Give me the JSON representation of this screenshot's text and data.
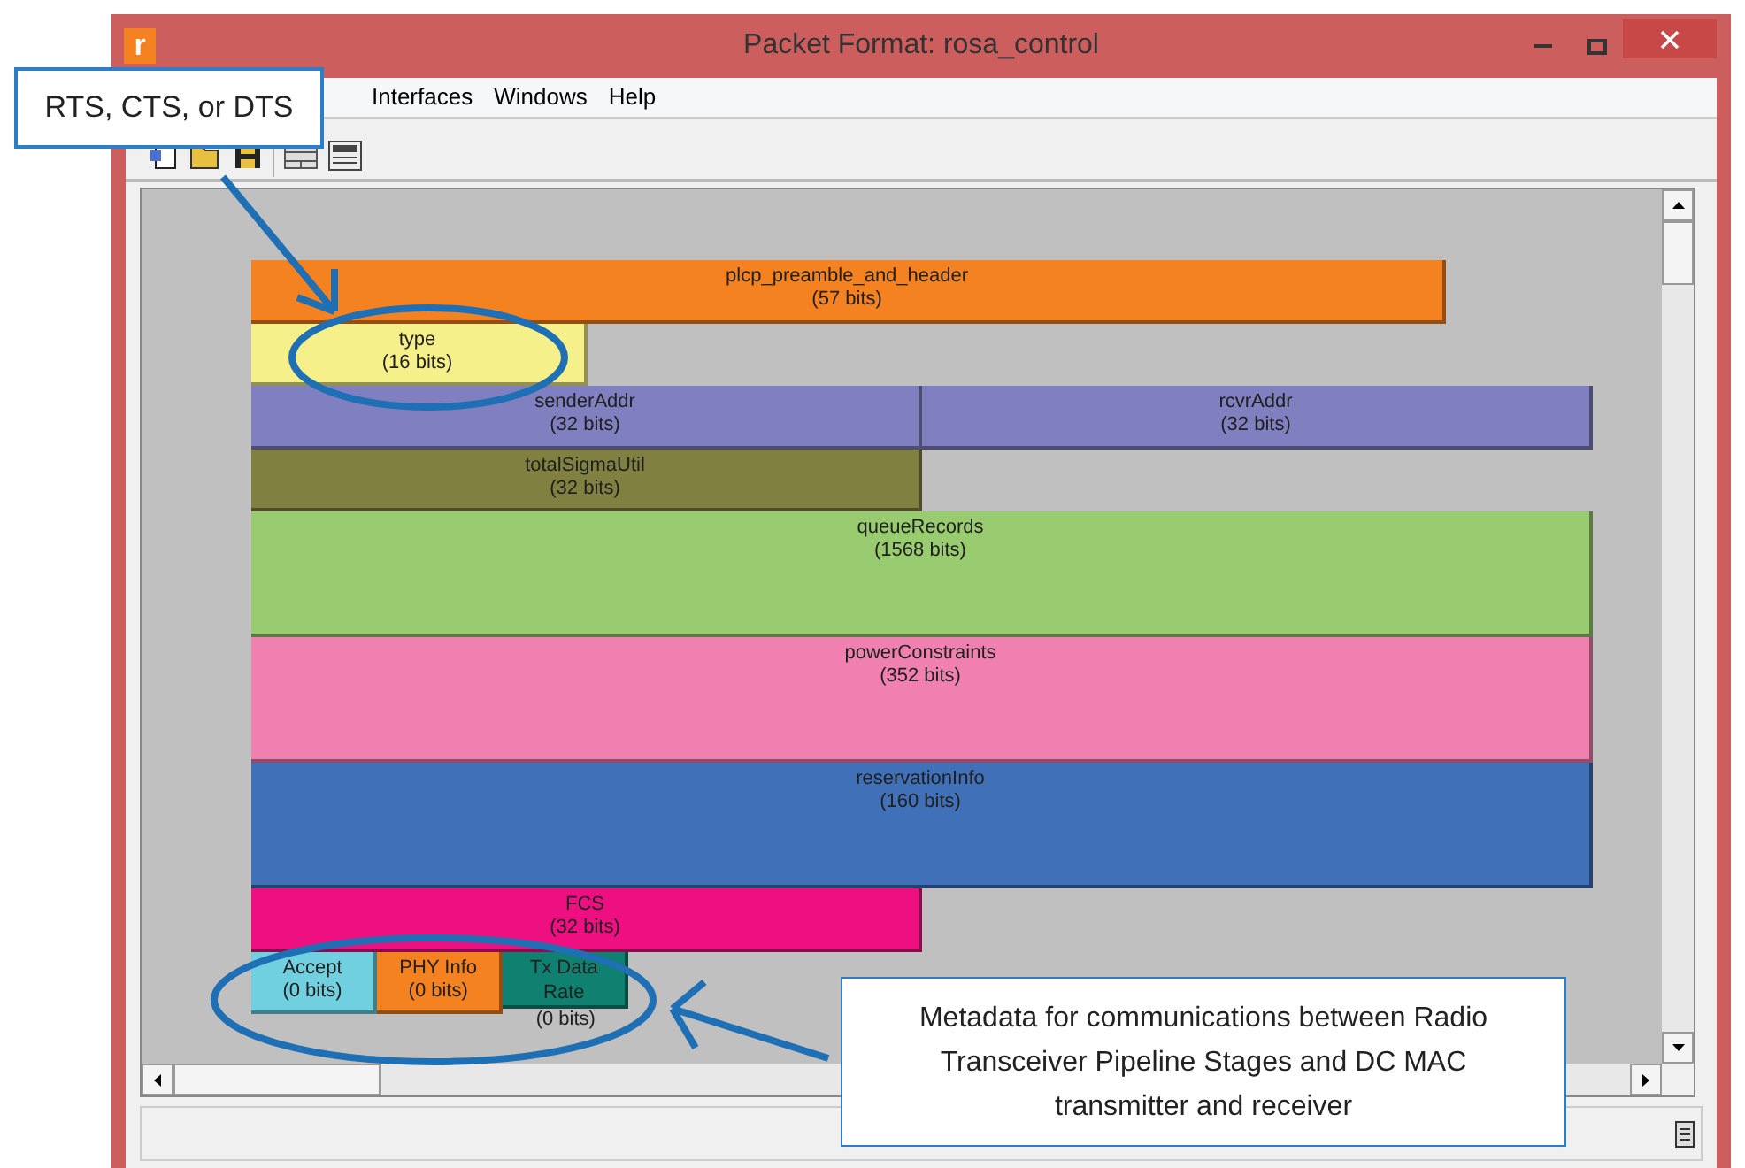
{
  "window": {
    "title": "Packet Format: rosa_control",
    "app_icon": "r"
  },
  "menu": [
    "Interfaces",
    "Windows",
    "Help"
  ],
  "fields": [
    {
      "name": "plcp_preamble_and_header",
      "size": "(57 bits)",
      "color": "#f58220"
    },
    {
      "name": "type",
      "size": "(16 bits)",
      "color": "#f5f08a"
    },
    {
      "name": "senderAddr",
      "size": "(32 bits)",
      "color": "#8080c0"
    },
    {
      "name": "rcvrAddr",
      "size": "(32 bits)",
      "color": "#8080c0"
    },
    {
      "name": "totalSigmaUtil",
      "size": "(32 bits)",
      "color": "#808040"
    },
    {
      "name": "queueRecords",
      "size": "(1568 bits)",
      "color": "#99cc70"
    },
    {
      "name": "powerConstraints",
      "size": "(352 bits)",
      "color": "#f080b0"
    },
    {
      "name": "reservationInfo",
      "size": "(160 bits)",
      "color": "#4070b8"
    },
    {
      "name": "FCS",
      "size": "(32 bits)",
      "color": "#ee1080"
    },
    {
      "name": "Accept",
      "size": "(0 bits)",
      "color": "#70d0e0"
    },
    {
      "name": "PHY Info",
      "size": "(0 bits)",
      "color": "#f58220"
    },
    {
      "name": "Tx Data Rate",
      "size": "(0 bits)",
      "color": "#108070"
    }
  ],
  "annotations": [
    {
      "text": "RTS, CTS, or DTS"
    },
    {
      "text": "Metadata for communications between Radio Transceiver Pipeline Stages and DC MAC transmitter and receiver"
    }
  ]
}
